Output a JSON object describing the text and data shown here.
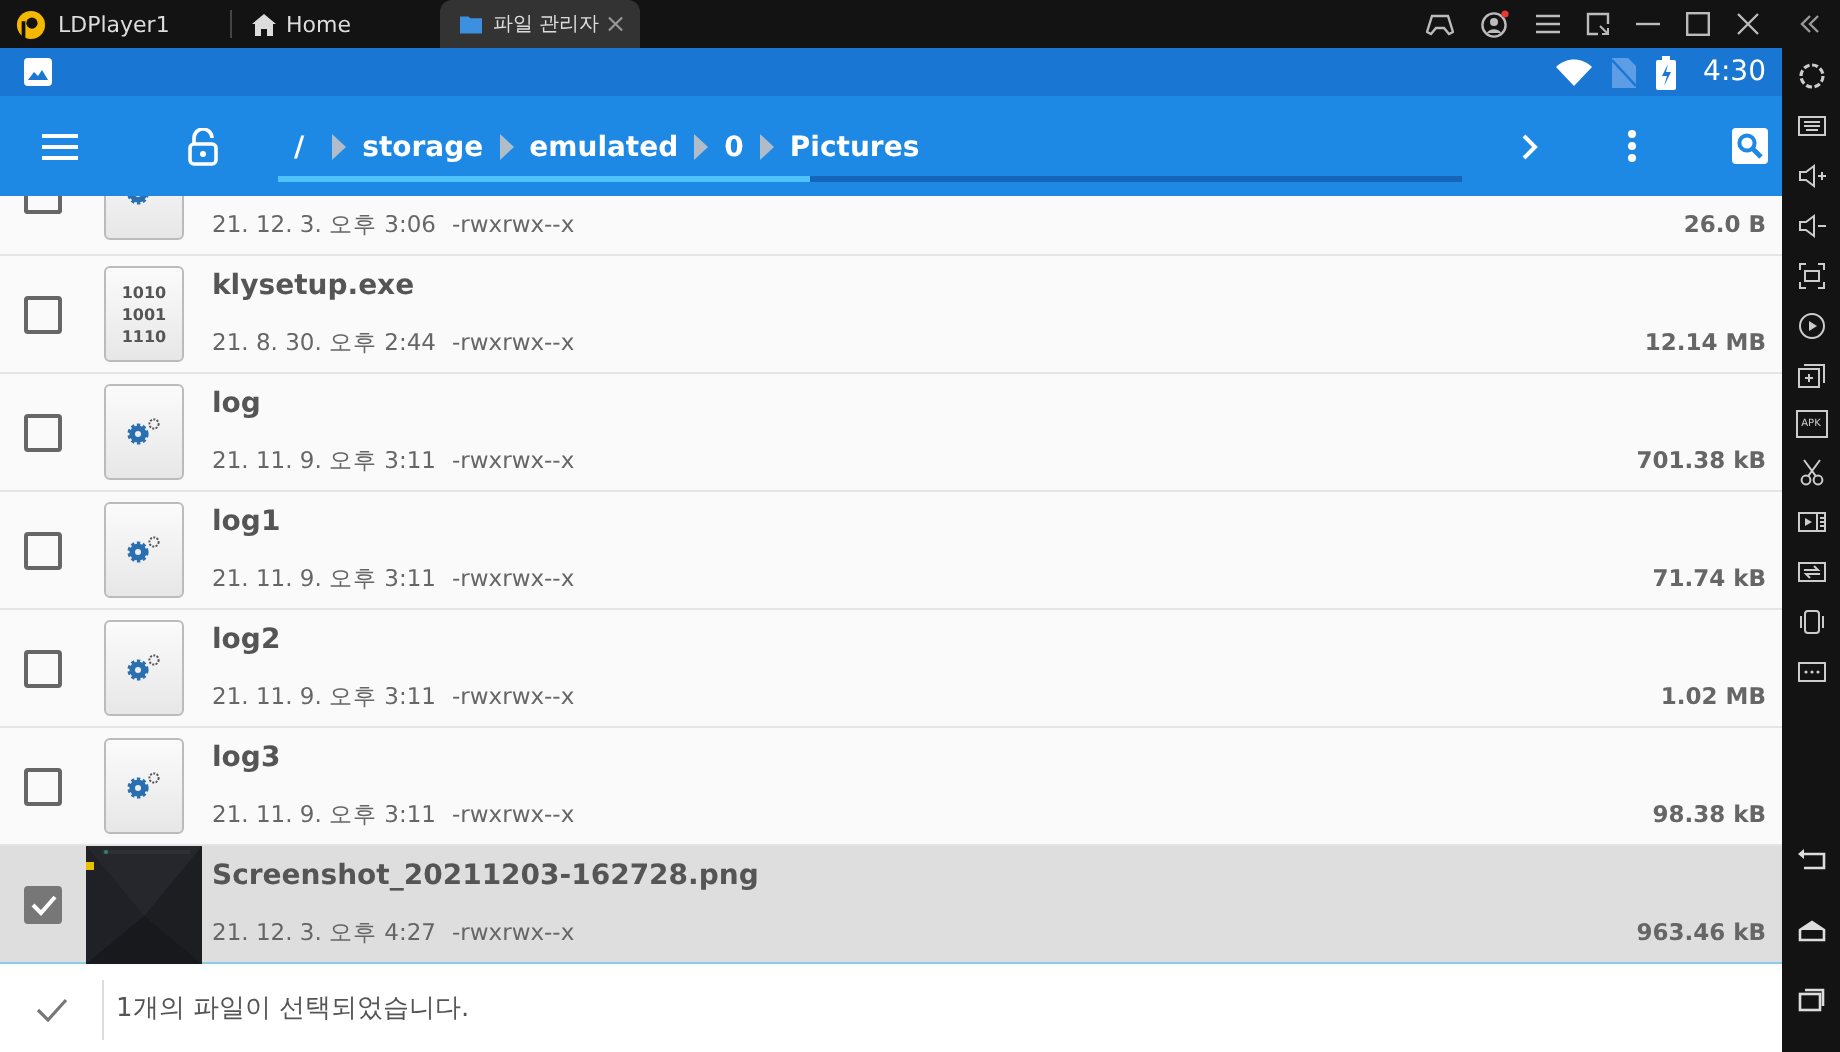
{
  "window": {
    "app_name": "LDPlayer1",
    "tabs": [
      {
        "kind": "home",
        "label": "Home",
        "selected": false
      },
      {
        "kind": "folder",
        "label": "파일 관리자",
        "selected": true,
        "closable": true
      }
    ]
  },
  "status_bar": {
    "time": "4:30"
  },
  "toolbar": {
    "path": [
      "/",
      "storage",
      "emulated",
      "0",
      "Pictures"
    ],
    "level": 0.45
  },
  "files": [
    {
      "kind": "settings",
      "date": "21. 12. 3. 오후 3:06",
      "permissions": "-rwxrwx--x",
      "size": "26.0 B",
      "checked": false
    },
    {
      "kind": "binary",
      "icon_text": [
        "1010",
        "1001",
        "1110"
      ],
      "name": "klysetup.exe",
      "date": "21. 8. 30. 오후 2:44",
      "permissions": "-rwxrwx--x",
      "size": "12.14 MB",
      "checked": false
    },
    {
      "kind": "settings",
      "name": "log",
      "date": "21. 11. 9. 오후 3:11",
      "permissions": "-rwxrwx--x",
      "size": "701.38 kB",
      "checked": false
    },
    {
      "kind": "settings",
      "name": "log1",
      "date": "21. 11. 9. 오후 3:11",
      "permissions": "-rwxrwx--x",
      "size": "71.74 kB",
      "checked": false
    },
    {
      "kind": "settings",
      "name": "log2",
      "date": "21. 11. 9. 오후 3:11",
      "permissions": "-rwxrwx--x",
      "size": "1.02 MB",
      "checked": false
    },
    {
      "kind": "settings",
      "name": "log3",
      "date": "21. 11. 9. 오후 3:11",
      "permissions": "-rwxrwx--x",
      "size": "98.38 kB",
      "checked": false
    },
    {
      "kind": "picture",
      "name": "Screenshot_20211203-162728.png",
      "date": "21. 12. 3. 오후 4:27",
      "permissions": "-rwxrwx--x",
      "size": "963.46 kB",
      "checked": true
    }
  ],
  "selection_bar": {
    "message": "1개의 파일이 선택되었습니다."
  },
  "sidebar": {
    "tools": [
      {
        "kind": "settings"
      },
      {
        "kind": "keyboard"
      },
      {
        "kind": "volume-up"
      },
      {
        "kind": "volume-down"
      },
      {
        "kind": "screenshot"
      },
      {
        "kind": "record"
      },
      {
        "kind": "multi"
      },
      {
        "kind": "apk",
        "label": "APK"
      },
      {
        "kind": "scissors"
      },
      {
        "kind": "video"
      },
      {
        "kind": "sync"
      },
      {
        "kind": "shake"
      },
      {
        "kind": "more"
      }
    ],
    "nav": [
      {
        "kind": "back"
      },
      {
        "kind": "home"
      },
      {
        "kind": "recents"
      }
    ]
  }
}
